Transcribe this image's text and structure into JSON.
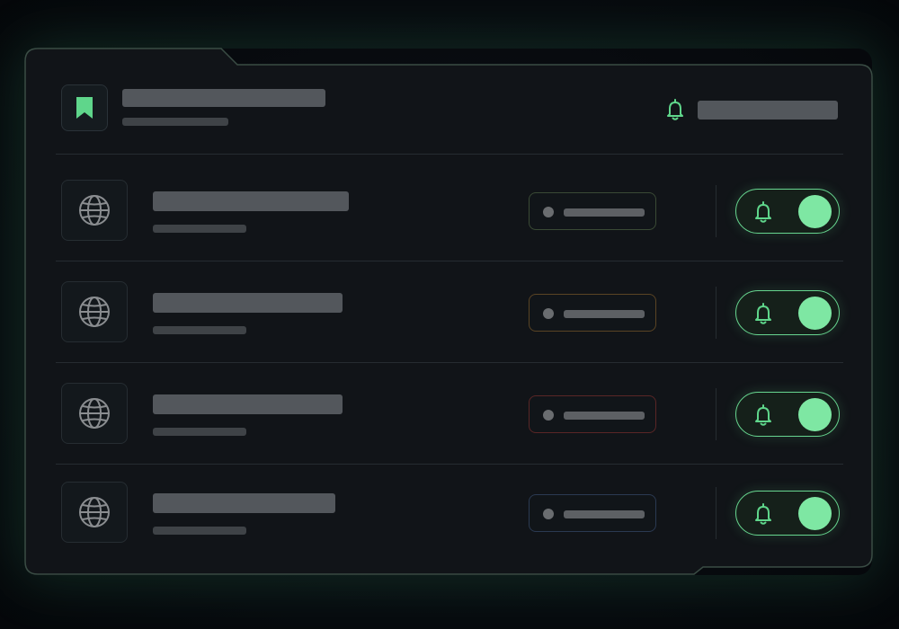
{
  "header": {
    "bookmark_icon": "bookmark-icon",
    "notification_icon": "bell-icon",
    "accent_color": "#5fd68b"
  },
  "rows": [
    {
      "icon": "globe-icon",
      "status_color": "#3a4a35",
      "notifications_enabled": true
    },
    {
      "icon": "globe-icon",
      "status_color": "#5a4424",
      "notifications_enabled": true
    },
    {
      "icon": "globe-icon",
      "status_color": "#5a2626",
      "notifications_enabled": true
    },
    {
      "icon": "globe-icon",
      "status_color": "#2b3a52",
      "notifications_enabled": true
    }
  ],
  "toggle": {
    "icon": "bell-icon",
    "on_color": "#7ee7a3"
  }
}
